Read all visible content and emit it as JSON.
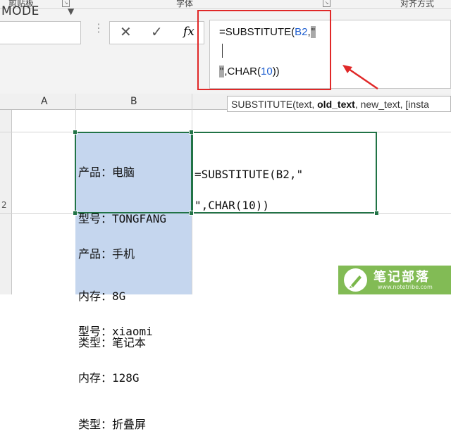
{
  "ribbon": {
    "clipboard_label": "剪贴板",
    "font_label": "字体",
    "alignment_label": "对齐方式"
  },
  "namebox": {
    "value": "MODE"
  },
  "formula_bar": {
    "line1_prefix": "=SUBSTITUTE(",
    "line1_ref": "B2",
    "line1_sep": ",",
    "line1_quote": "\"",
    "line2_quote": "\"",
    "line2_mid": ",CHAR(",
    "line2_num": "10",
    "line2_end": "))",
    "fx_label": "fx"
  },
  "tooltip": {
    "func": "SUBSTITUTE(text, ",
    "arg_active": "old_text",
    "rest": ", new_text, [insta"
  },
  "columns": [
    "A",
    "B"
  ],
  "rows": [
    "2"
  ],
  "cells": {
    "B2_lines": [
      "产品：电脑",
      "型号：TONGFANG",
      "",
      "内存：8G",
      "类型：笔记本"
    ],
    "B3_lines": [
      "产品：手机",
      "",
      "型号：xiaomi",
      "内存：128G",
      "类型：折叠屏"
    ],
    "C2_line1": "=SUBSTITUTE(B2,\"",
    "C2_line2": "\",CHAR(10))"
  },
  "watermark": {
    "name": "笔记部落",
    "url": "www.notetribe.com"
  },
  "colors": {
    "selection_border": "#217346",
    "annotation": "#e02828",
    "selection_fill": "#c5d6ee"
  }
}
